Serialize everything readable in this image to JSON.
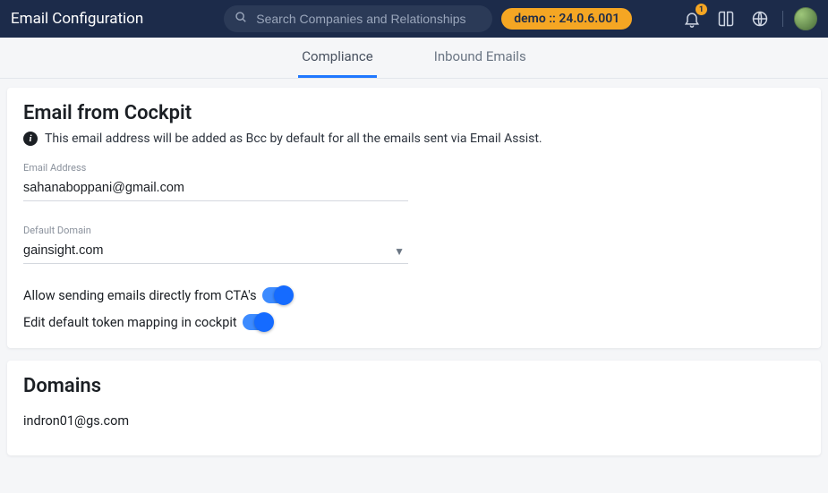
{
  "header": {
    "title": "Email Configuration",
    "search_placeholder": "Search Companies and Relationships",
    "env_pill": "demo :: 24.0.6.001",
    "notif_count": "1"
  },
  "tabs": {
    "compliance": "Compliance",
    "inbound": "Inbound Emails"
  },
  "cockpit": {
    "heading": "Email from Cockpit",
    "info": "This email address will be added as Bcc by default for all the emails sent via Email Assist.",
    "email_label": "Email Address",
    "email_value": "sahanaboppani@gmail.com",
    "domain_label": "Default Domain",
    "domain_value": "gainsight.com",
    "allow_label": "Allow sending emails directly from CTA's",
    "edit_label": "Edit default token mapping in cockpit"
  },
  "domains": {
    "heading": "Domains",
    "items": [
      "indron01@gs.com"
    ]
  }
}
